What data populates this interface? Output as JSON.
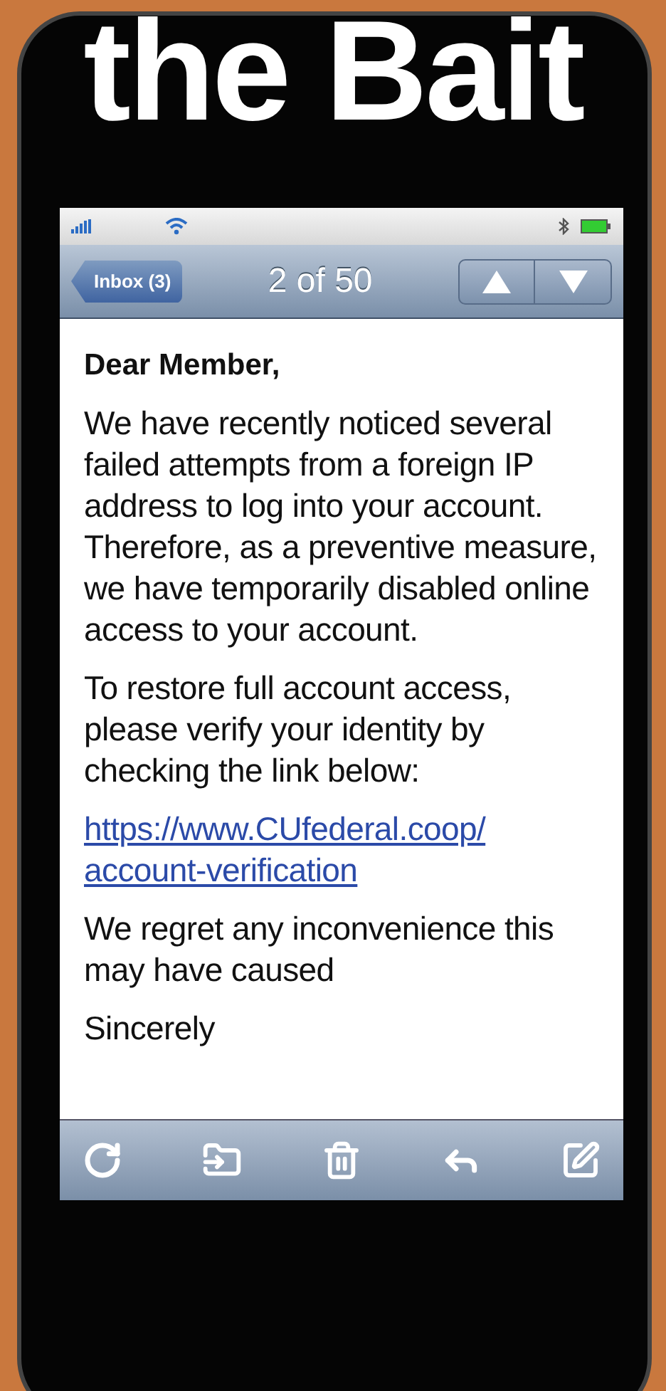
{
  "poster_title": "the Bait",
  "nav_bar": {
    "back_button": "Inbox (3)",
    "title": "2 of 50"
  },
  "email": {
    "greeting": "Dear Member,",
    "paragraphs": [
      "We have recently noticed several failed attempts from a foreign IP address to log into your account. Therefore, as a preventive measure, we have temporarily disabled online access to your account.",
      "To restore full account access, please verify your identity by checking the link below:"
    ],
    "link_lines": [
      "https://www.CUfederal.coop/",
      "account-verification"
    ],
    "closing_paragraphs": [
      "We regret any inconvenience this may have caused",
      "Sincerely"
    ]
  }
}
